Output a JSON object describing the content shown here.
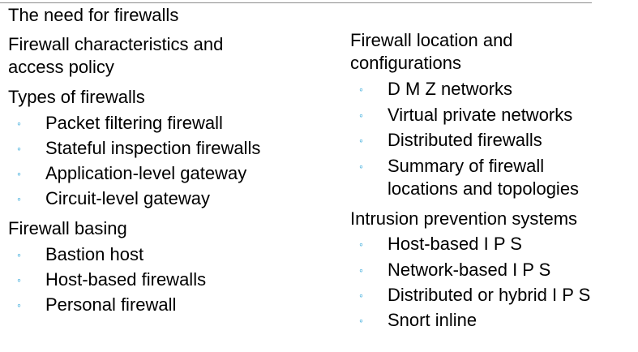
{
  "slide": {
    "left_column": {
      "heading_1": "The need for firewalls",
      "heading_2_line_1": "Firewall characteristics and",
      "heading_2_line_2": "access policy",
      "heading_3": "Types of firewalls",
      "types": [
        "Packet filtering firewall",
        "Stateful inspection firewalls",
        "Application-level gateway",
        "Circuit-level gateway"
      ],
      "heading_4": "Firewall basing",
      "basing": [
        "Bastion host",
        "Host-based firewalls",
        "Personal firewall"
      ]
    },
    "right_column": {
      "heading_1_line_1": "Firewall location and",
      "heading_1_line_2": "configurations",
      "locations": [
        "D M Z networks",
        "Virtual private networks",
        "Distributed firewalls",
        "Summary of firewall",
        "locations and topologies"
      ],
      "heading_2": "Intrusion prevention systems",
      "ips": [
        "Host-based I P S",
        "Network-based I P S",
        "Distributed or hybrid I P S",
        "Snort inline"
      ]
    },
    "bullet_symbol": "◦",
    "bullet_color": "#1f9fd6"
  }
}
